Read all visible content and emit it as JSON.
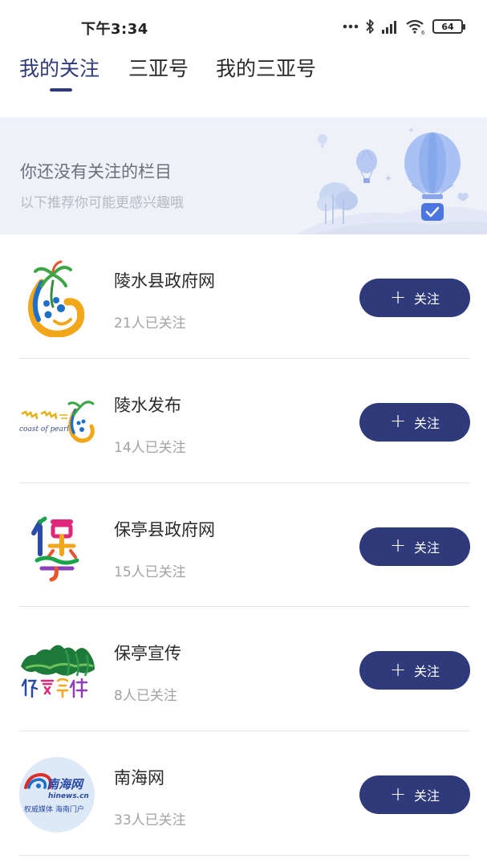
{
  "status_bar": {
    "time": "下午3:34",
    "battery": "64",
    "icons": [
      "more-dots-icon",
      "bluetooth-icon",
      "signal-icon",
      "wifi-icon",
      "battery-icon"
    ]
  },
  "tabs": [
    {
      "label": "我的关注",
      "active": true
    },
    {
      "label": "三亚号",
      "active": false
    },
    {
      "label": "我的三亚号",
      "active": false
    }
  ],
  "banner": {
    "title": "你还没有关注的栏目",
    "subtitle": "以下推荐你可能更感兴趣哦",
    "illustration": "hot-air-balloon-illustration"
  },
  "items": [
    {
      "name": "陵水县政府网",
      "count": "21人已关注",
      "follow_label": "关注",
      "logo": "lingshui-gov-logo"
    },
    {
      "name": "陵水发布",
      "count": "14人已关注",
      "follow_label": "关注",
      "logo": "lingshui-release-logo",
      "logo_text": "coast of pearl"
    },
    {
      "name": "保亭县政府网",
      "count": "15人已关注",
      "follow_label": "关注",
      "logo": "baoting-gov-logo"
    },
    {
      "name": "保亭宣传",
      "count": "8人已关注",
      "follow_label": "关注",
      "logo": "baoting-publicity-logo"
    },
    {
      "name": "南海网",
      "count": "33人已关注",
      "follow_label": "关注",
      "logo": "hinews-logo",
      "logo_text": [
        "南海网",
        "hinews.cn",
        "权威媒体 海南门户"
      ]
    }
  ],
  "colors": {
    "accent": "#2e3a7a",
    "banner_bg": "#eef1f8",
    "muted_text": "#a3a3a3"
  }
}
